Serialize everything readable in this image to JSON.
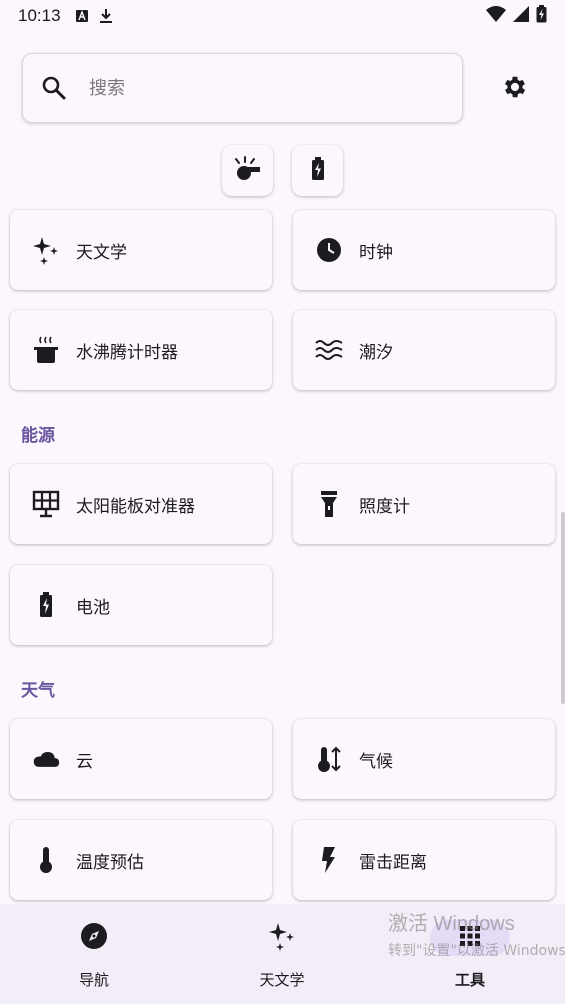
{
  "status_bar": {
    "time": "10:13",
    "icons": [
      "a-notification-icon",
      "download-icon",
      "wifi-icon",
      "signal-icon",
      "battery-charging-icon"
    ]
  },
  "search": {
    "placeholder": "搜索",
    "value": ""
  },
  "quick_tools": [
    {
      "name": "whistle-icon"
    },
    {
      "name": "battery-icon"
    }
  ],
  "tools": [
    {
      "label": "天文学",
      "icon": "sparkles-icon"
    },
    {
      "label": "时钟",
      "icon": "clock-icon"
    },
    {
      "label": "水沸腾计时器",
      "icon": "pot-icon"
    },
    {
      "label": "潮汐",
      "icon": "waves-icon"
    }
  ],
  "sections": {
    "energy": {
      "title": "能源",
      "items": [
        {
          "label": "太阳能板对准器",
          "icon": "solar-panel-icon"
        },
        {
          "label": "照度计",
          "icon": "flashlight-icon"
        },
        {
          "label": "电池",
          "icon": "battery-icon"
        }
      ]
    },
    "weather": {
      "title": "天气",
      "items": [
        {
          "label": "云",
          "icon": "cloud-icon"
        },
        {
          "label": "气候",
          "icon": "thermometer-arrows-icon"
        },
        {
          "label": "温度预估",
          "icon": "thermometer-icon"
        },
        {
          "label": "雷击距离",
          "icon": "lightning-icon"
        }
      ]
    }
  },
  "bottom_nav": [
    {
      "label": "导航",
      "icon": "compass-icon",
      "active": false
    },
    {
      "label": "天文学",
      "icon": "sparkles-icon",
      "active": false
    },
    {
      "label": "工具",
      "icon": "grid-icon",
      "active": true
    }
  ],
  "watermark": {
    "line1": "激活 Windows",
    "line2": "转到\"设置\"以激活 Windows"
  },
  "colors": {
    "background": "#fcf7fc",
    "accent": "#6a56a0",
    "nav_background": "#f3edf7",
    "nav_active_pill": "#e6dbf7",
    "text": "#1c1b1f"
  }
}
